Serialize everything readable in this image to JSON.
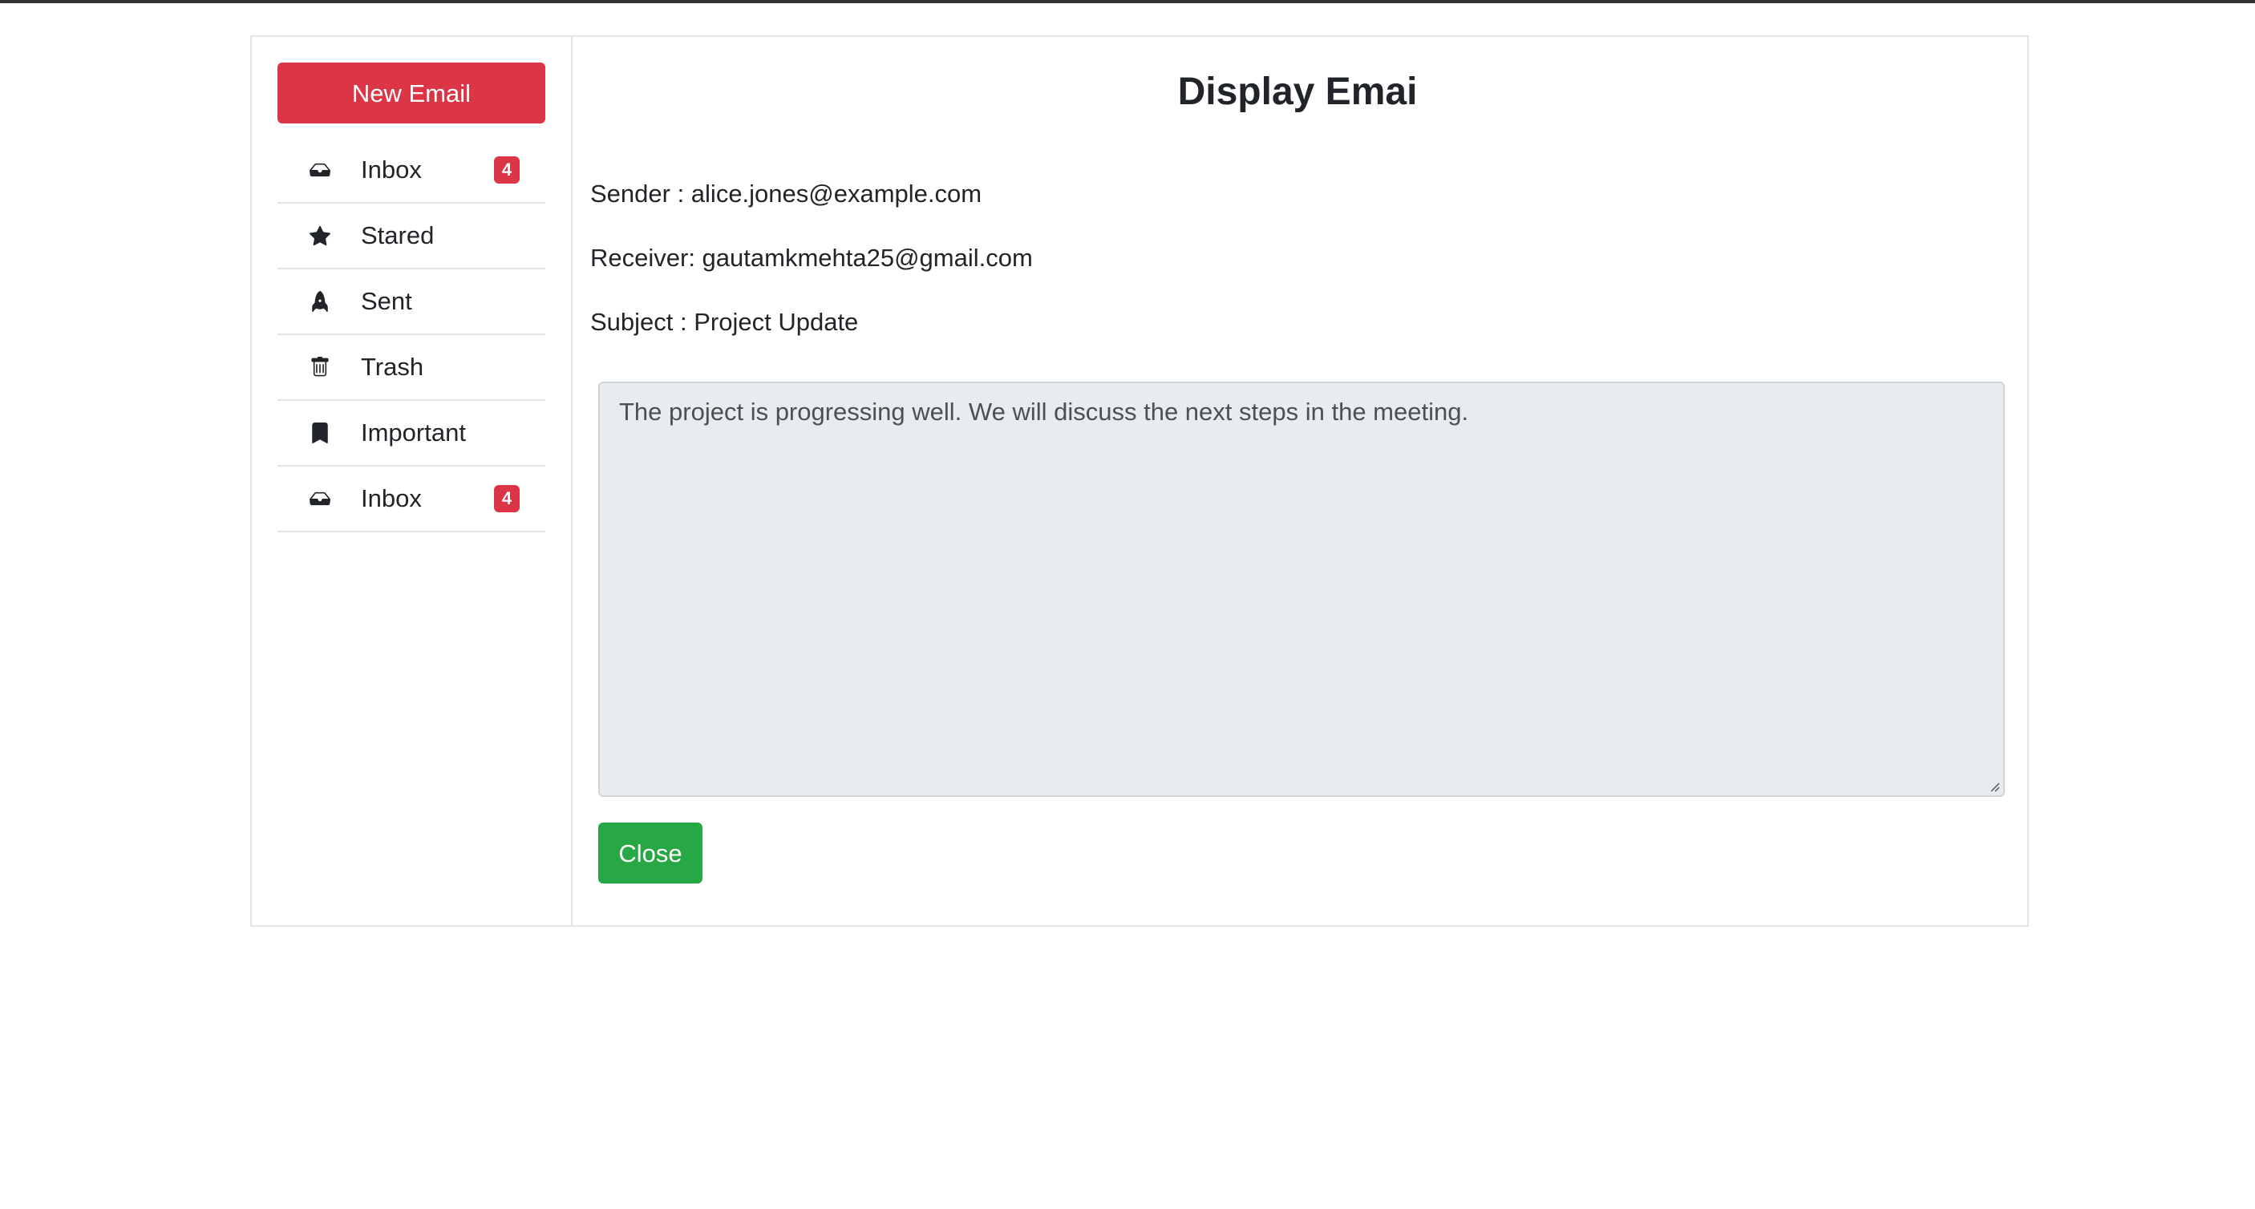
{
  "sidebar": {
    "new_email_label": "New Email",
    "items": [
      {
        "label": "Inbox",
        "icon": "inbox-icon",
        "badge": "4"
      },
      {
        "label": "Stared",
        "icon": "star-icon",
        "badge": null
      },
      {
        "label": "Sent",
        "icon": "rocket-icon",
        "badge": null
      },
      {
        "label": "Trash",
        "icon": "trash-icon",
        "badge": null
      },
      {
        "label": "Important",
        "icon": "bookmark-icon",
        "badge": null
      },
      {
        "label": "Inbox",
        "icon": "inbox-icon",
        "badge": "4"
      }
    ]
  },
  "main": {
    "title": "Display Emai",
    "sender": "Sender : alice.jones@example.com",
    "receiver": "Receiver: gautamkmehta25@gmail.com",
    "subject": "Subject : Project Update",
    "body": "The project is progressing well. We will discuss the next steps in the meeting.",
    "close_label": "Close"
  },
  "colors": {
    "danger": "#dc3545",
    "success": "#28a745",
    "textarea_bg": "#e9ecef"
  }
}
